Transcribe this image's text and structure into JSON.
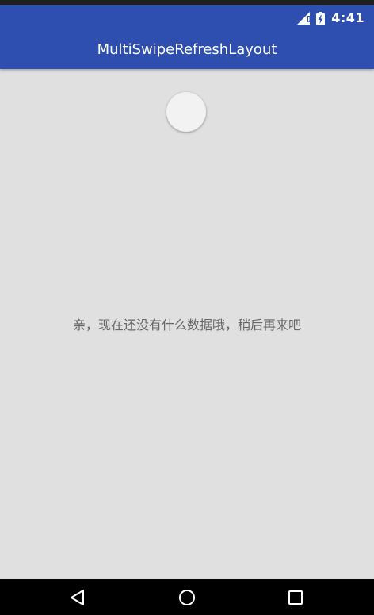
{
  "status_bar": {
    "time": "4:41",
    "icons": [
      "signal-icon",
      "battery-charging-icon"
    ]
  },
  "app_bar": {
    "title": "MultiSwipeRefreshLayout"
  },
  "content": {
    "refresh_indicator": "refresh-spinner",
    "empty_message": "亲，现在还没有什么数据哦，稍后再来吧"
  },
  "nav_bar": {
    "icons": [
      "back-icon",
      "home-icon",
      "recents-icon"
    ]
  },
  "colors": {
    "primary": "#2f4fb0",
    "background": "#e0e0e0",
    "text_secondary": "#666666",
    "nav_bar": "#000000"
  }
}
